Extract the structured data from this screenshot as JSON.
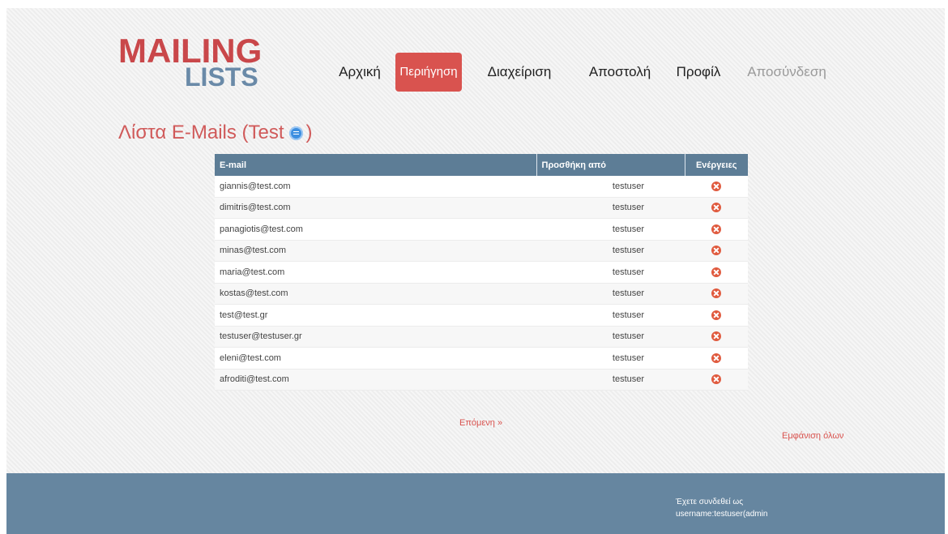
{
  "logo": {
    "line1": "MAILING",
    "line2": "LISTS"
  },
  "nav": {
    "items": [
      {
        "label": "Αρχική"
      },
      {
        "label": "Περιήγηση"
      },
      {
        "label": "Διαχείριση"
      },
      {
        "label": "Αποστολή"
      },
      {
        "label": "Προφίλ"
      },
      {
        "label": "Αποσύνδεση"
      }
    ]
  },
  "page": {
    "title": "Λίστα E-Mails (Test",
    "title_close": ")"
  },
  "table": {
    "headers": {
      "email": "E-mail",
      "added_by": "Προσθήκη από",
      "actions": "Ενέργειες"
    },
    "rows": [
      {
        "email": "giannis@test.com",
        "added_by": "testuser"
      },
      {
        "email": "dimitris@test.com",
        "added_by": "testuser"
      },
      {
        "email": "panagiotis@test.com",
        "added_by": "testuser"
      },
      {
        "email": "minas@test.com",
        "added_by": "testuser"
      },
      {
        "email": "maria@test.com",
        "added_by": "testuser"
      },
      {
        "email": "kostas@test.com",
        "added_by": "testuser"
      },
      {
        "email": "test@test.gr",
        "added_by": "testuser"
      },
      {
        "email": "testuser@testuser.gr",
        "added_by": "testuser"
      },
      {
        "email": "eleni@test.com",
        "added_by": "testuser"
      },
      {
        "email": "afroditi@test.com",
        "added_by": "testuser"
      }
    ]
  },
  "pagination": {
    "next": "Επόμενη »"
  },
  "search_all": "Εμφάνιση όλων",
  "footer": {
    "login_line1": "Έχετε συνδεθεί ως",
    "login_line2": "username:testuser(admin"
  },
  "colors": {
    "accent": "#d9534f",
    "header_blue": "#5d7d96",
    "footer_blue": "#6686a0",
    "delete_icon": "#e05a3e",
    "info_icon": "#3d8fe0"
  },
  "icons": {
    "title_info": "info-icon",
    "row_action": "delete-icon"
  }
}
